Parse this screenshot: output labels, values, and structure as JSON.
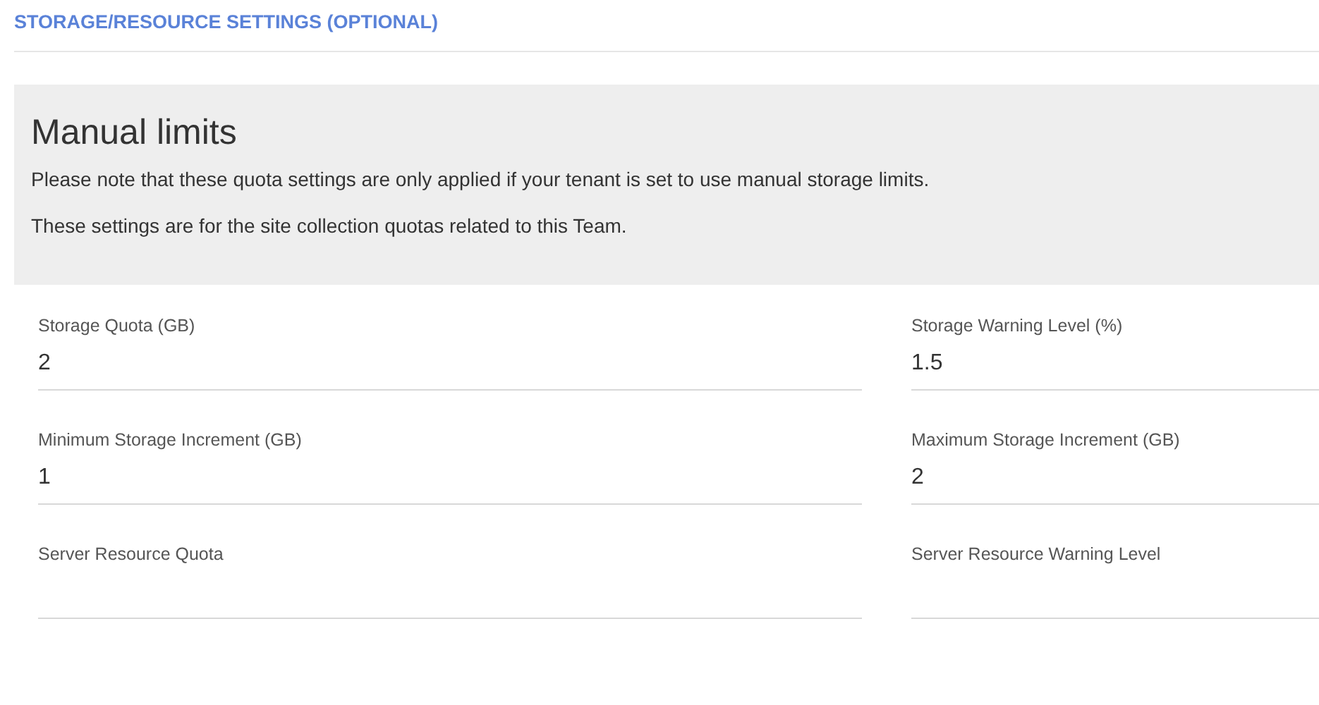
{
  "section_title": "STORAGE/RESOURCE SETTINGS (OPTIONAL)",
  "notice": {
    "title": "Manual limits",
    "lines": [
      "Please note that these quota settings are only applied if your tenant is set to use manual storage limits.",
      "These settings are for the site collection quotas related to this Team."
    ]
  },
  "fields": [
    {
      "label": "Storage Quota (GB)",
      "value": "2"
    },
    {
      "label": "Storage Warning Level (%)",
      "value": "1.5"
    },
    {
      "label": "Minimum Storage Increment (GB)",
      "value": "1"
    },
    {
      "label": "Maximum Storage Increment (GB)",
      "value": "2"
    },
    {
      "label": "Server Resource Quota"
    },
    {
      "label": "Server Resource Warning Level"
    }
  ]
}
